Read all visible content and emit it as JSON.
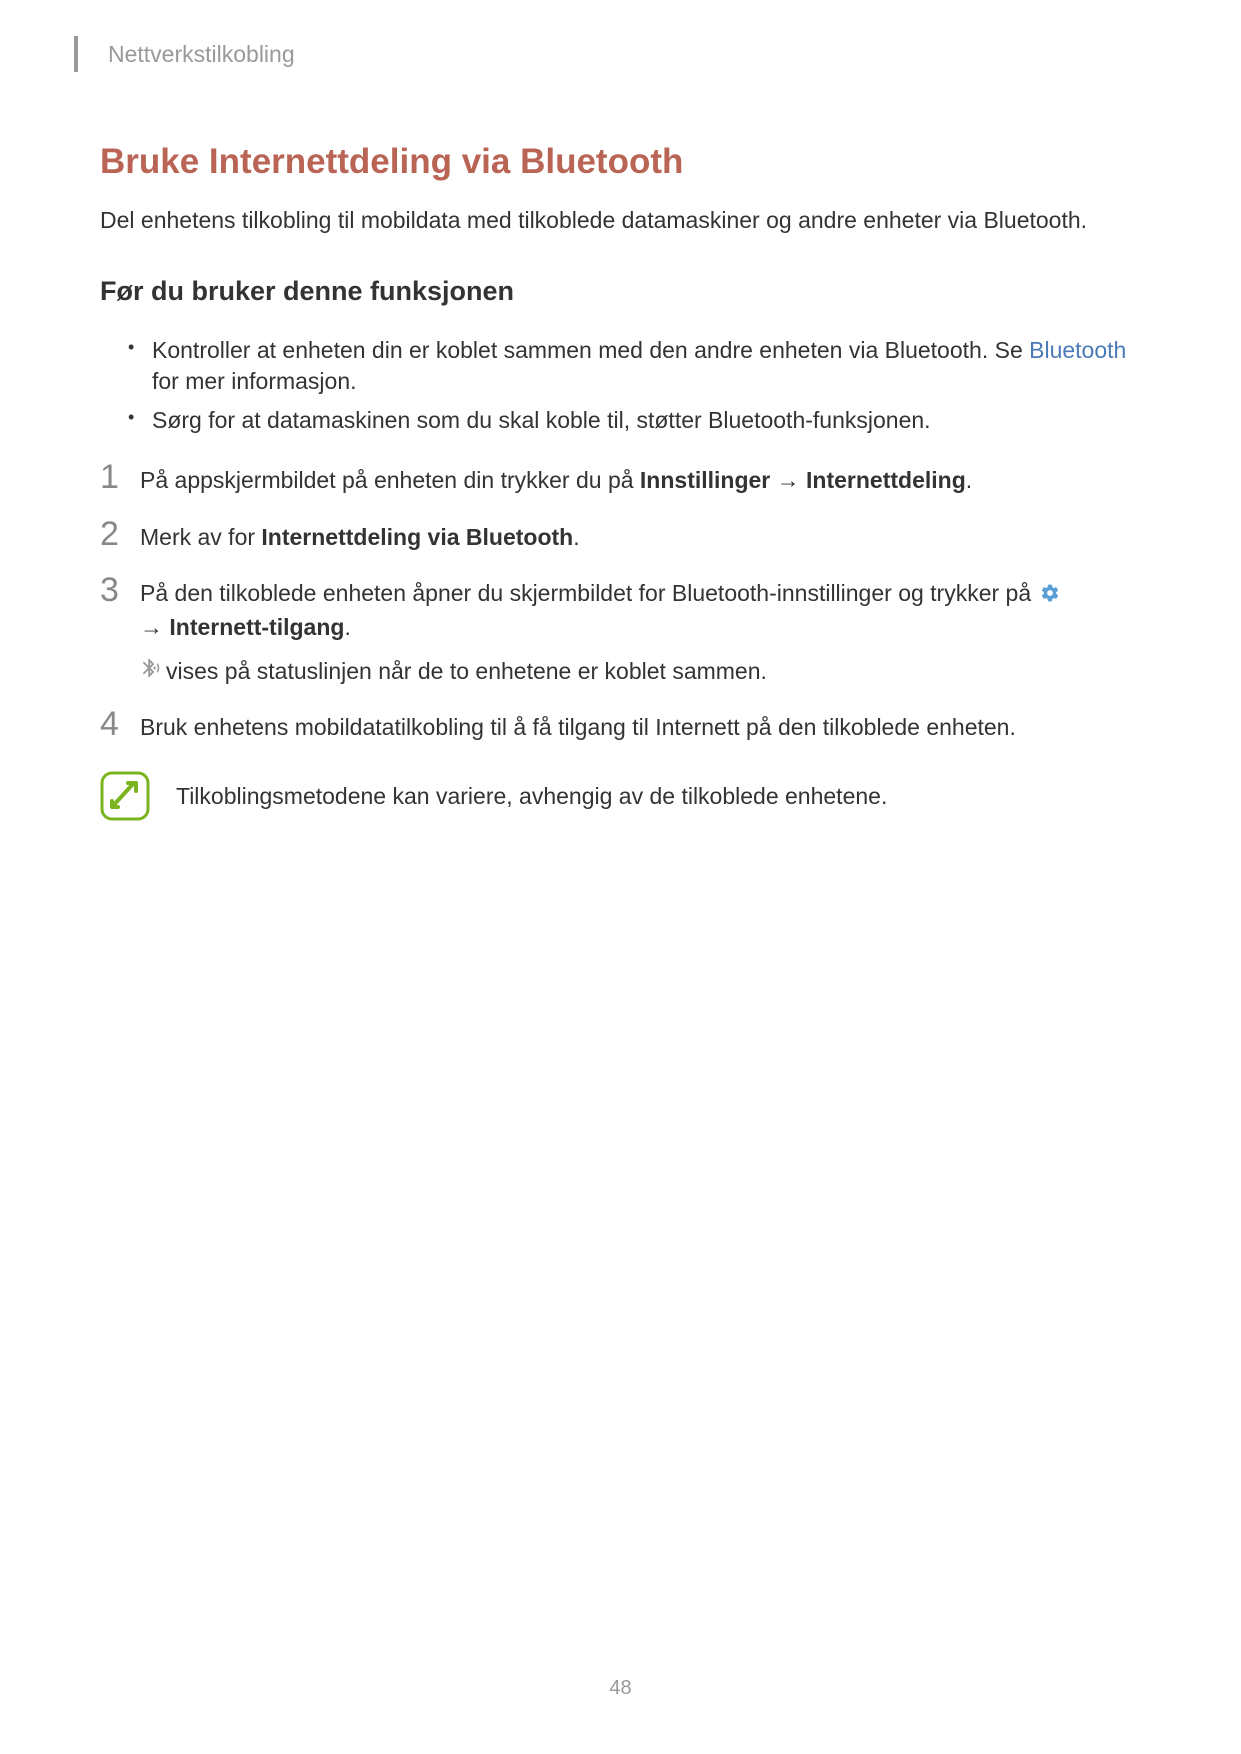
{
  "header": {
    "title": "Nettverkstilkobling"
  },
  "main_heading": "Bruke Internettdeling via Bluetooth",
  "intro": "Del enhetens tilkobling til mobildata med tilkoblede datamaskiner og andre enheter via Bluetooth.",
  "subheading": "Før du bruker denne funksjonen",
  "bullets": [
    {
      "pre": "Kontroller at enheten din er koblet sammen med den andre enheten via Bluetooth. Se ",
      "link": "Bluetooth",
      "post": " for mer informasjon."
    },
    {
      "pre": "Sørg for at datamaskinen som du skal koble til, støtter Bluetooth-funksjonen.",
      "link": "",
      "post": ""
    }
  ],
  "steps": [
    {
      "num": "1",
      "parts": [
        {
          "t": "På appskjermbildet på enheten din trykker du på ",
          "b": false
        },
        {
          "t": "Innstillinger",
          "b": true
        },
        {
          "t": " → ",
          "b": false
        },
        {
          "t": "Internettdeling",
          "b": true
        },
        {
          "t": ".",
          "b": false
        }
      ]
    },
    {
      "num": "2",
      "parts": [
        {
          "t": "Merk av for ",
          "b": false
        },
        {
          "t": "Internettdeling via Bluetooth",
          "b": true
        },
        {
          "t": ".",
          "b": false
        }
      ]
    },
    {
      "num": "3",
      "parts": [
        {
          "t": "På den tilkoblede enheten åpner du skjermbildet for Bluetooth-innstillinger og trykker på ",
          "b": false
        }
      ],
      "line2_parts": [
        {
          "t": "→ ",
          "b": false
        },
        {
          "t": "Internett-tilgang",
          "b": true
        },
        {
          "t": ".",
          "b": false
        }
      ],
      "status": " vises på statuslinjen når de to enhetene er koblet sammen."
    },
    {
      "num": "4",
      "parts": [
        {
          "t": "Bruk enhetens mobildatatilkobling til å få tilgang til Internett på den tilkoblede enheten.",
          "b": false
        }
      ]
    }
  ],
  "note": "Tilkoblingsmetodene kan variere, avhengig av de tilkoblede enhetene.",
  "page_number": "48"
}
